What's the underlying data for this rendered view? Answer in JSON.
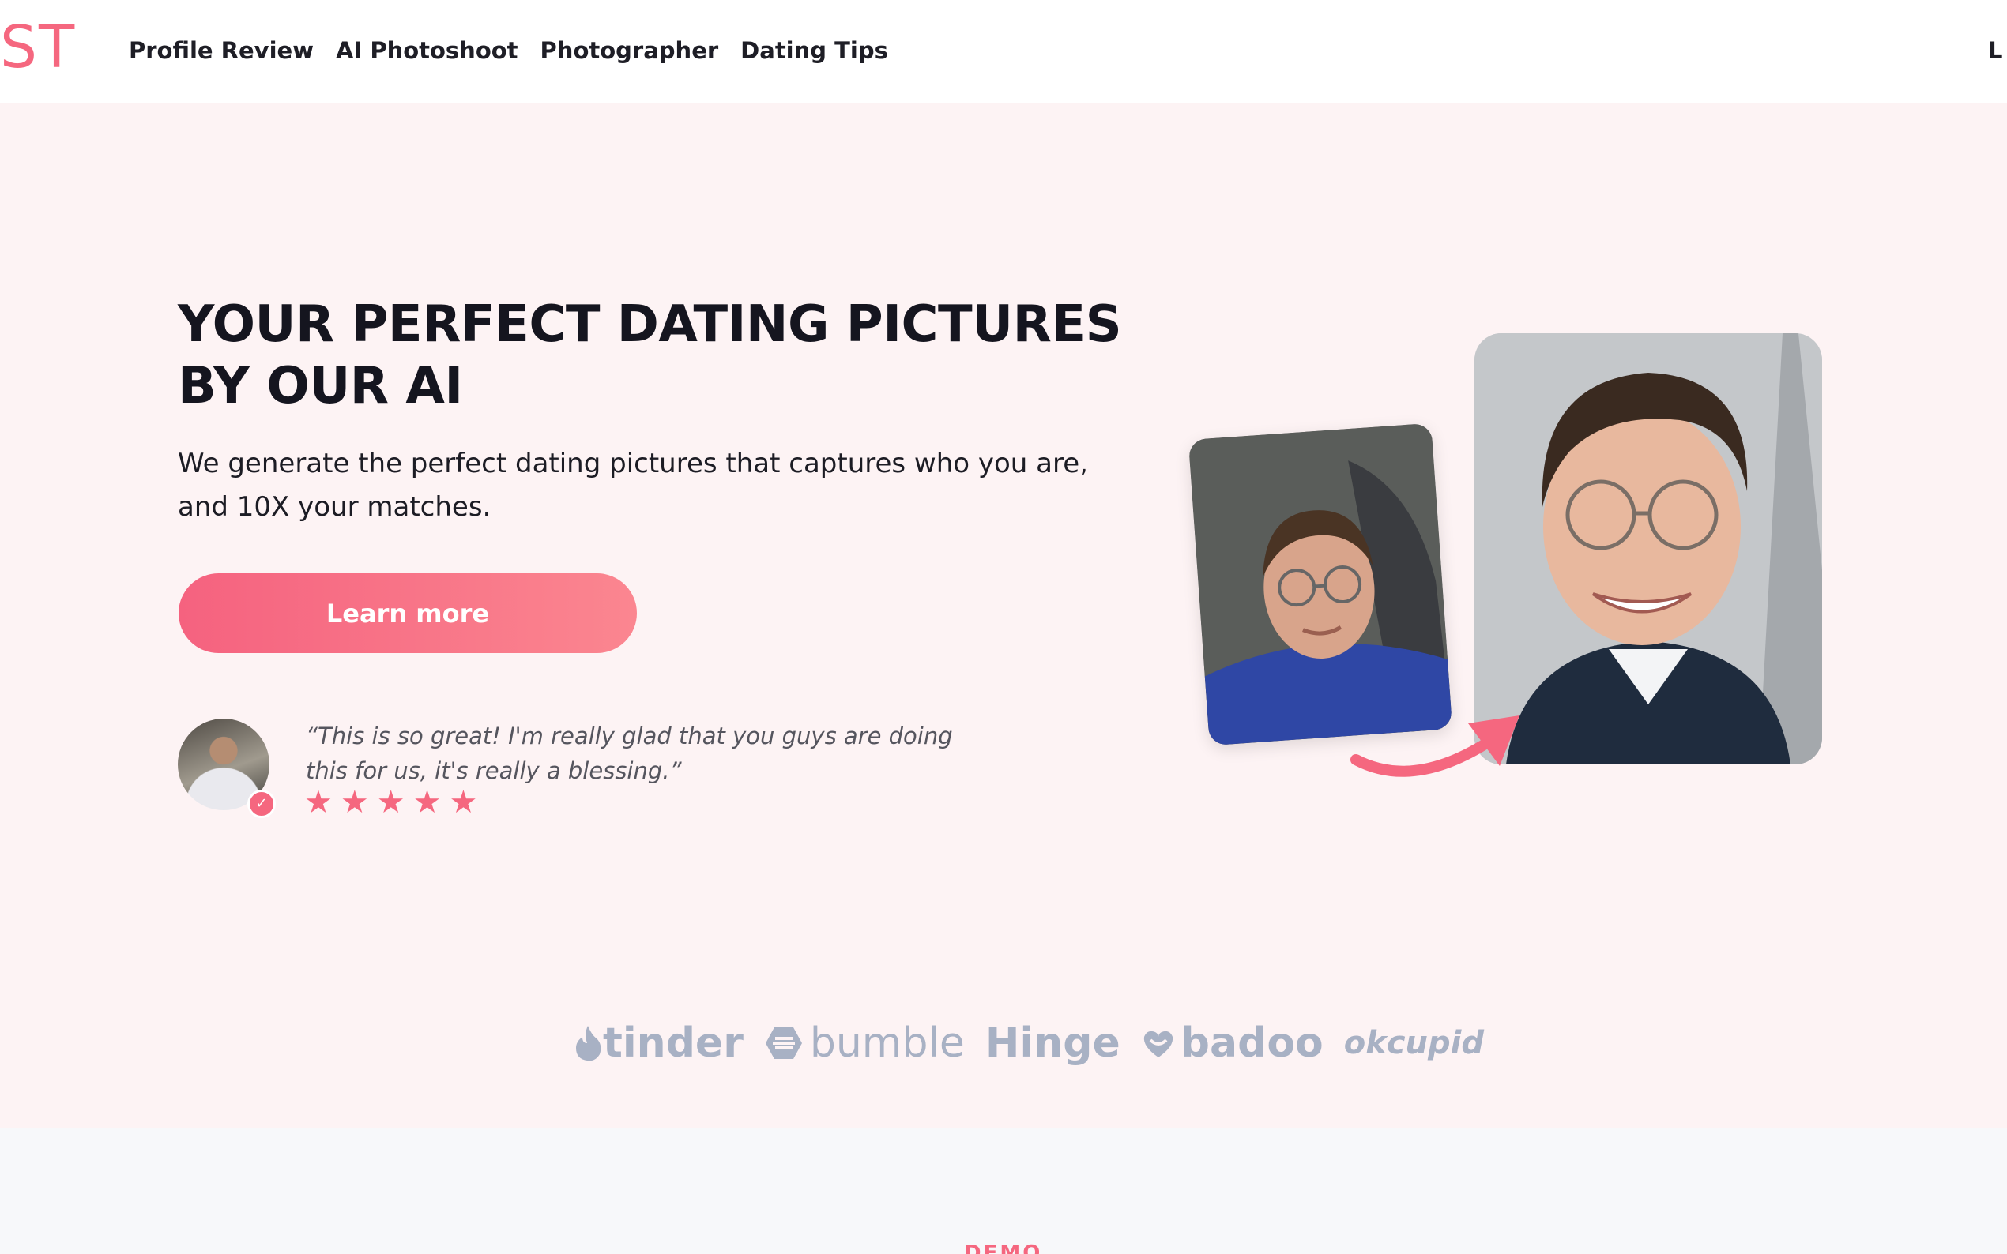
{
  "header": {
    "logo_text": "ST",
    "nav": [
      "Profile Review",
      "AI Photoshoot",
      "Photographer",
      "Dating Tips"
    ],
    "login_label": "L"
  },
  "hero": {
    "title": "YOUR PERFECT DATING PICTURES BY OUR AI",
    "subtitle": "We generate the perfect dating pictures that captures who you are, and 10X your matches.",
    "cta_label": "Learn more"
  },
  "testimonial": {
    "quote": "“This is so great! I'm really glad that you guys are doing this for us, it's really a blessing.”",
    "rating": 5,
    "verified_icon": "check-badge-icon"
  },
  "brands": [
    "tinder",
    "bumble",
    "Hinge",
    "badoo",
    "okcupid"
  ],
  "next_section_label": "DEMO",
  "colors": {
    "accent": "#f5677f",
    "hero_bg": "#fdf3f4",
    "brand_gray": "#a8b1c4"
  }
}
